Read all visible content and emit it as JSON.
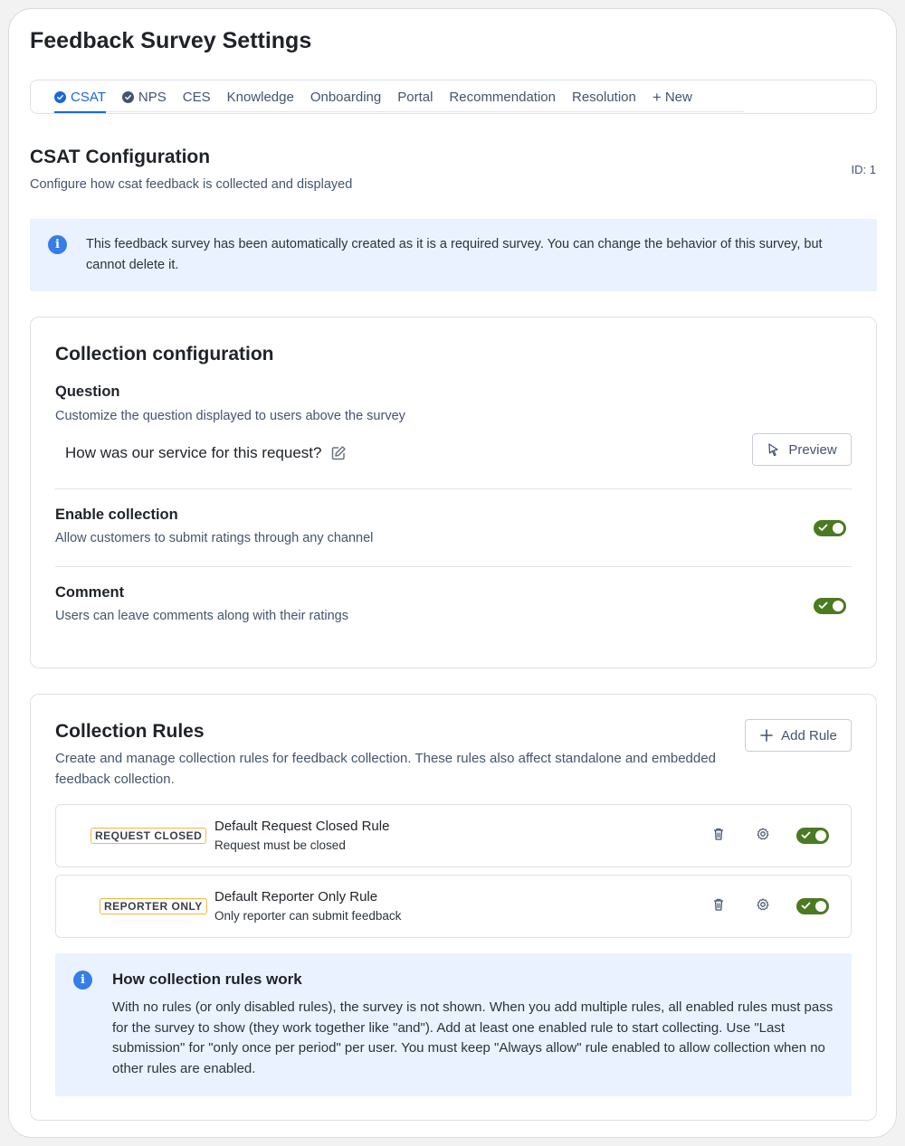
{
  "page": {
    "title": "Feedback Survey Settings"
  },
  "tabs": [
    {
      "label": "CSAT",
      "checked": true,
      "active": true
    },
    {
      "label": "NPS",
      "checked": true,
      "active": false
    },
    {
      "label": "CES",
      "checked": false,
      "active": false
    },
    {
      "label": "Knowledge",
      "checked": false,
      "active": false
    },
    {
      "label": "Onboarding",
      "checked": false,
      "active": false
    },
    {
      "label": "Portal",
      "checked": false,
      "active": false
    },
    {
      "label": "Recommendation",
      "checked": false,
      "active": false
    },
    {
      "label": "Resolution",
      "checked": false,
      "active": false
    },
    {
      "label": "New",
      "icon": "plus-icon"
    }
  ],
  "section": {
    "title": "CSAT Configuration",
    "subtitle": "Configure how csat feedback is collected and displayed",
    "id_label": "ID: 1"
  },
  "banner": {
    "text": "This feedback survey has been automatically created as it is a required survey. You can change the behavior of this survey, but cannot delete it."
  },
  "collection_config": {
    "title": "Collection configuration",
    "question": {
      "label": "Question",
      "description": "Customize the question displayed to users above the survey",
      "value": "How was our service for this request?",
      "preview_label": "Preview"
    },
    "enable_collection": {
      "label": "Enable collection",
      "description": "Allow customers to submit ratings through any channel",
      "enabled": true
    },
    "comment": {
      "label": "Comment",
      "description": "Users can leave comments along with their ratings",
      "enabled": true
    }
  },
  "collection_rules": {
    "title": "Collection Rules",
    "description": "Create and manage collection rules for feedback collection. These rules also affect standalone and embedded feedback collection.",
    "add_rule_label": "Add Rule",
    "rules": [
      {
        "badge": "REQUEST CLOSED",
        "title": "Default Request Closed Rule",
        "subtitle": "Request must be closed",
        "enabled": true
      },
      {
        "badge": "REPORTER ONLY",
        "title": "Default Reporter Only Rule",
        "subtitle": "Only reporter can submit feedback",
        "enabled": true
      }
    ],
    "help": {
      "title": "How collection rules work",
      "text": "With no rules (or only disabled rules), the survey is not shown. When you add multiple rules, all enabled rules must pass for the survey to show (they work together like \"and\"). Add at least one enabled rule to start collecting. Use \"Last submission\" for \"only once per period\" per user. You must keep \"Always allow\" rule enabled to allow collection when no other rules are enabled."
    }
  },
  "colors": {
    "accent": "#1868db",
    "toggle_on": "#4c7a22",
    "info_bg": "#e9f2fe",
    "info_icon": "#357de8",
    "lozenge_border": "#f5b840"
  }
}
